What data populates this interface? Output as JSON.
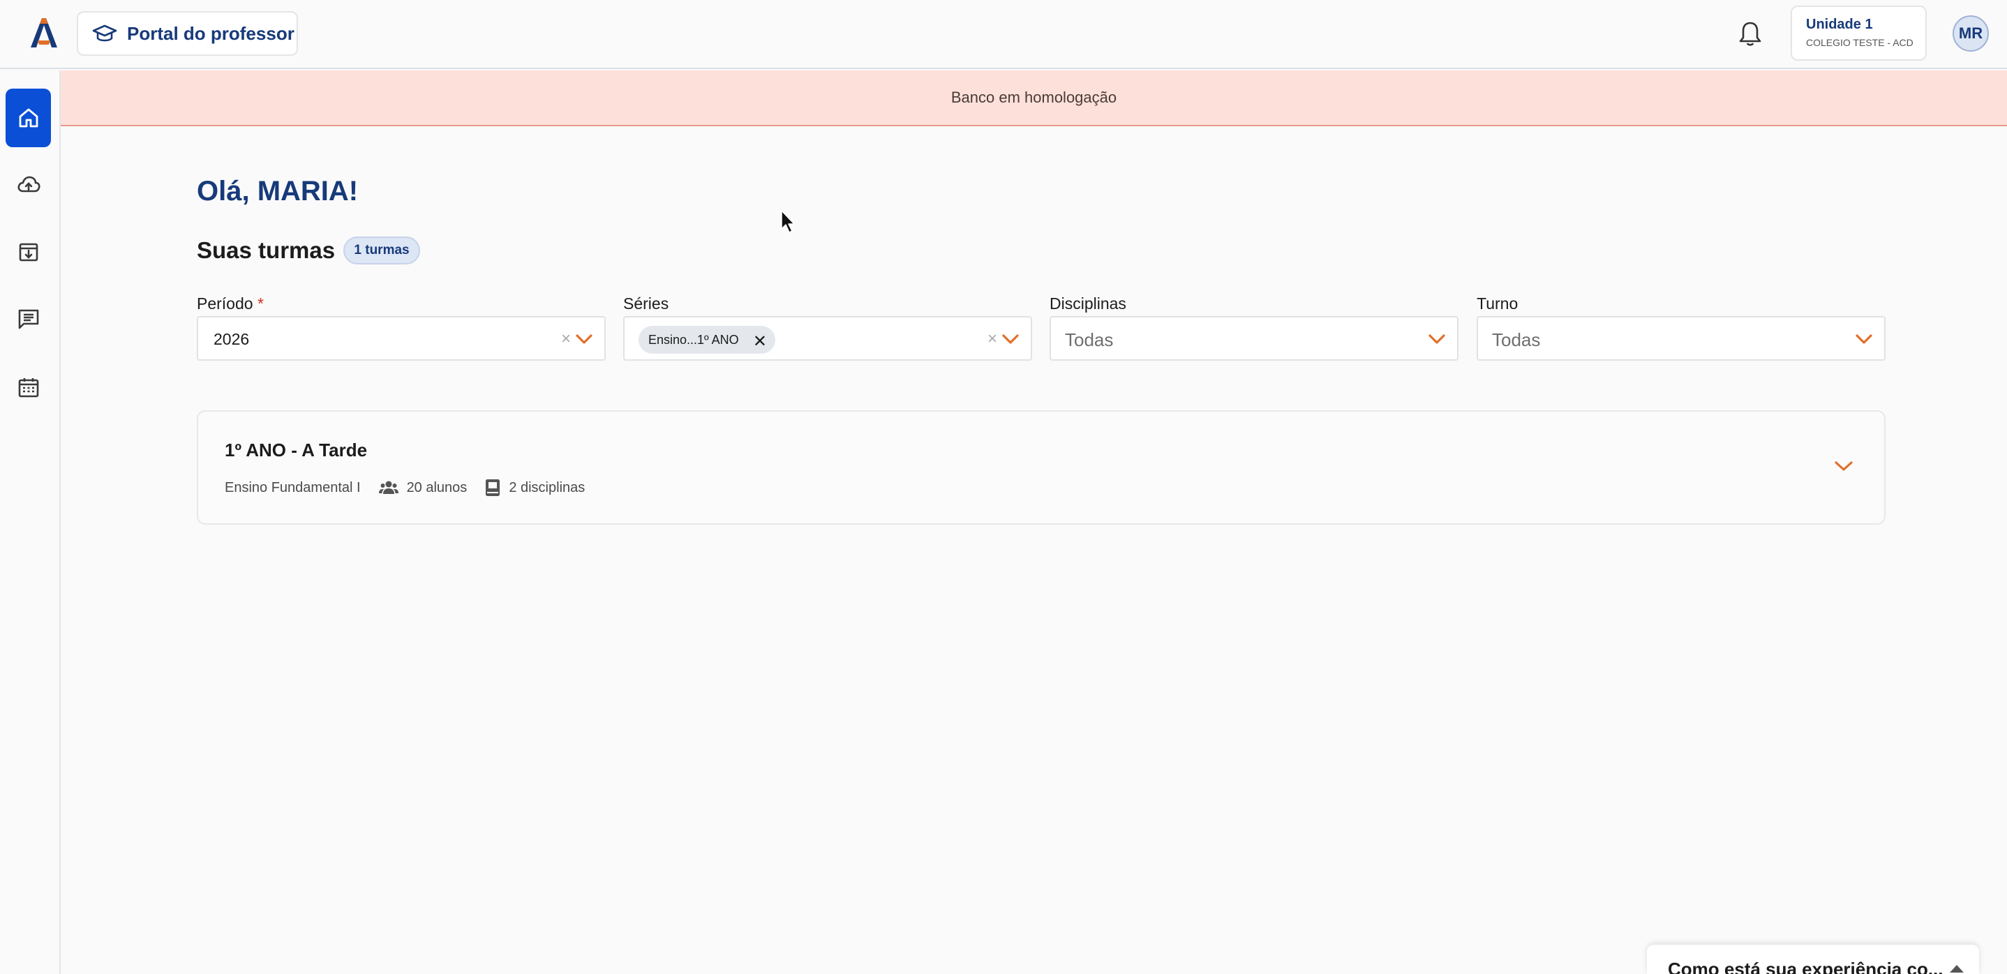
{
  "header": {
    "portal_label": "Portal do professor",
    "unit_name": "Unidade 1",
    "unit_school": "COLEGIO TESTE - ACD",
    "user_initials": "MR"
  },
  "sidebar": {
    "items": [
      {
        "name": "home-icon",
        "active": true
      },
      {
        "name": "cloud-upload-icon",
        "active": false
      },
      {
        "name": "download-box-icon",
        "active": false
      },
      {
        "name": "messages-icon",
        "active": false
      },
      {
        "name": "calendar-icon",
        "active": false
      }
    ]
  },
  "banner": {
    "text": "Banco em homologação"
  },
  "main": {
    "greeting": "Olá, MARIA!",
    "classes_title": "Suas turmas",
    "classes_count": "1 turmas"
  },
  "filters": {
    "period": {
      "label": "Período",
      "required_mark": "*",
      "value": "2026",
      "clear": "×"
    },
    "series": {
      "label": "Séries",
      "tag": "Ensino...1º ANO",
      "tag_remove": "✕",
      "clear": "×"
    },
    "disciplines": {
      "label": "Disciplinas",
      "value": "Todas"
    },
    "shift": {
      "label": "Turno",
      "value": "Todas"
    }
  },
  "class_card": {
    "title": "1º ANO - A Tarde",
    "level": "Ensino Fundamental I",
    "students": "20 alunos",
    "subjects": "2 disciplinas"
  },
  "feedback": {
    "text": "Como está sua experiência co..."
  },
  "colors": {
    "brand_blue": "#173a7a",
    "active_blue": "#0a4fd6",
    "accent_orange": "#e0702a",
    "banner_bg": "#fde0da"
  }
}
